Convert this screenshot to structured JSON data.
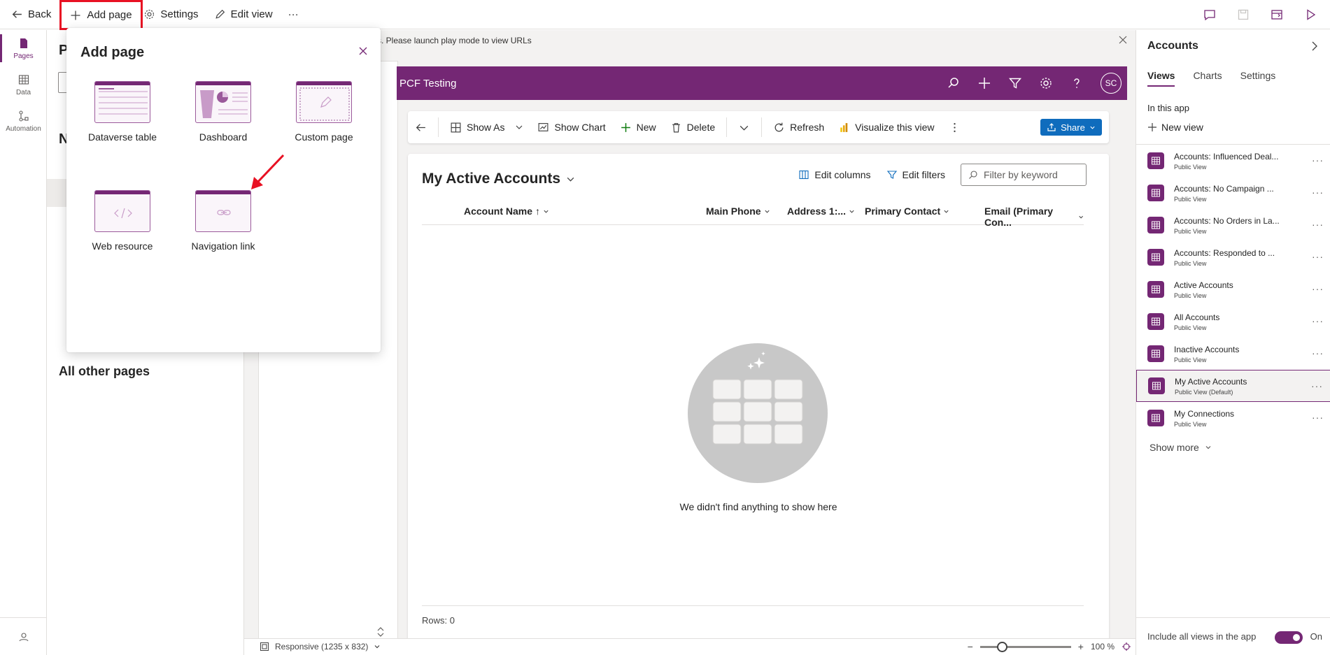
{
  "topbar": {
    "back_label": "Back",
    "add_page_label": "Add page",
    "settings_label": "Settings",
    "edit_view_label": "Edit view",
    "more_label": "···"
  },
  "rail": {
    "items": [
      {
        "label": "Pages",
        "icon": "page-icon"
      },
      {
        "label": "Data",
        "icon": "table-icon"
      },
      {
        "label": "Automation",
        "icon": "flow-icon"
      }
    ]
  },
  "pages_panel": {
    "title_initial": "P",
    "section_initial": "N",
    "all_other_pages": "All other pages"
  },
  "flyout": {
    "title": "Add page",
    "tiles": [
      {
        "label": "Dataverse table"
      },
      {
        "label": "Dashboard"
      },
      {
        "label": "Custom page"
      },
      {
        "label": "Web resource"
      },
      {
        "label": "Navigation link"
      }
    ]
  },
  "canvas": {
    "notice": "s. Please launch play mode to view URLs",
    "app_title": "PCF Testing",
    "avatar_initials": "SC",
    "commands": {
      "show_as": "Show As",
      "show_chart": "Show Chart",
      "new": "New",
      "delete": "Delete",
      "refresh": "Refresh",
      "visualize": "Visualize this view",
      "share": "Share"
    },
    "grid": {
      "view_title": "My Active Accounts",
      "edit_columns": "Edit columns",
      "edit_filters": "Edit filters",
      "filter_placeholder": "Filter by keyword",
      "columns": [
        "Account Name",
        "Main Phone",
        "Address 1:...",
        "Primary Contact",
        "Email (Primary Con..."
      ],
      "sort_indicator": "↑",
      "empty_message": "We didn't find anything to show here",
      "rows_label": "Rows: 0"
    },
    "status": {
      "responsive": "Responsive (1235 x 832)",
      "zoom": "100 %",
      "zoom_level": 1.0
    }
  },
  "right_panel": {
    "title": "Accounts",
    "tabs": [
      {
        "label": "Views",
        "active": true
      },
      {
        "label": "Charts",
        "active": false
      },
      {
        "label": "Settings",
        "active": false
      }
    ],
    "in_this_app": "In this app",
    "new_view": "New view",
    "views": [
      {
        "name": "Accounts: Influenced Deal...",
        "sub": "Public View"
      },
      {
        "name": "Accounts: No Campaign ...",
        "sub": "Public View"
      },
      {
        "name": "Accounts: No Orders in La...",
        "sub": "Public View"
      },
      {
        "name": "Accounts: Responded to ...",
        "sub": "Public View"
      },
      {
        "name": "Active Accounts",
        "sub": "Public View"
      },
      {
        "name": "All Accounts",
        "sub": "Public View"
      },
      {
        "name": "Inactive Accounts",
        "sub": "Public View"
      },
      {
        "name": "My Active Accounts",
        "sub": "Public View (Default)",
        "active": true
      },
      {
        "name": "My Connections",
        "sub": "Public View"
      }
    ],
    "show_more": "Show more",
    "include_all_views": "Include all views in the app",
    "toggle_state": "On"
  },
  "colors": {
    "brand": "#742774",
    "highlight_border": "#e81123",
    "share_button": "#0f6cbd"
  }
}
